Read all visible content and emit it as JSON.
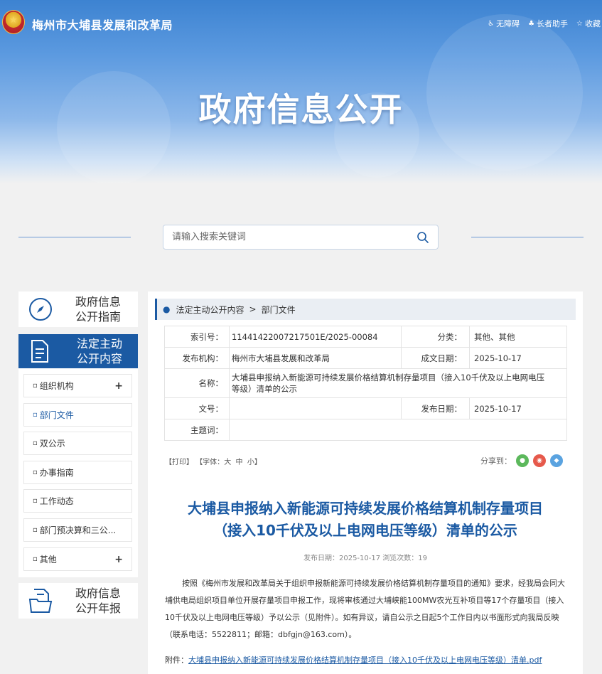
{
  "header": {
    "site_name": "梅州市大埔县发展和改革局",
    "links": [
      {
        "icon": "accessibility-icon",
        "glyph": "♿",
        "label": "无障碍"
      },
      {
        "icon": "elder-assist-icon",
        "glyph": "♣",
        "label": "长者助手"
      },
      {
        "icon": "star-icon",
        "glyph": "☆",
        "label": "收藏"
      }
    ],
    "banner_title": "政府信息公开"
  },
  "search": {
    "placeholder": "请输入搜索关键词"
  },
  "sidebar": {
    "guide": {
      "line1": "政府信息",
      "line2": "公开指南"
    },
    "active": {
      "line1": "法定主动",
      "line2": "公开内容"
    },
    "annual": {
      "line1": "政府信息",
      "line2": "公开年报"
    },
    "items": [
      {
        "label": "组织机构",
        "expand": "+"
      },
      {
        "label": "部门文件",
        "expand": ""
      },
      {
        "label": "双公示",
        "expand": ""
      },
      {
        "label": "办事指南",
        "expand": ""
      },
      {
        "label": "工作动态",
        "expand": ""
      },
      {
        "label": "部门预决算和三公...",
        "expand": ""
      },
      {
        "label": "其他",
        "expand": "+"
      }
    ]
  },
  "breadcrumb": {
    "parent": "法定主动公开内容",
    "separator": ">",
    "current": "部门文件"
  },
  "meta": {
    "index_label": "索引号：",
    "index_value": "11441422007217501E/2025-00084",
    "category_label": "分类：",
    "category_value": "其他、其他",
    "org_label": "发布机构：",
    "org_value": "梅州市大埔县发展和改革局",
    "date_created_label": "成文日期：",
    "date_created_value": "2025-10-17",
    "name_label": "名称：",
    "name_value": "大埔县申报纳入新能源可持续发展价格结算机制存量项目（接入10千伏及以上电网电压等级）清单的公示",
    "docno_label": "文号：",
    "docno_value": "",
    "date_published_label": "发布日期：",
    "date_published_value": "2025-10-17",
    "keywords_label": "主题词：",
    "keywords_value": ""
  },
  "tools": {
    "print": "【打印】",
    "font_prefix": "【字体：",
    "font_large": "大",
    "font_medium": "中",
    "font_small": "小",
    "font_suffix": "】",
    "share_label": "分享到："
  },
  "share_colors": {
    "wechat": "#5cb85c",
    "weibo": "#e6594b",
    "qq": "#5aa3e0"
  },
  "article": {
    "title_line1": "大埔县申报纳入新能源可持续发展价格结算机制存量项目",
    "title_line2": "（接入10千伏及以上电网电压等级）清单的公示",
    "info": "发布日期：2025-10-17  浏览次数：19",
    "body": "按照《梅州市发展和改革局关于组织申报新能源可持续发展价格结算机制存量项目的通知》要求，经我局会同大埔供电局组织项目单位开展存量项目申报工作，现将审核通过大埔峡能100MW农光互补项目等17个存量项目（接入10千伏及以上电网电压等级）予以公示（见附件）。如有异议，请自公示之日起5个工作日内以书面形式向我局反映（联系电话：5522811；邮箱：dbfgjn@163.com）。",
    "attachment_label": "附件：",
    "attachment_link": "大埔县申报纳入新能源可持续发展价格结算机制存量项目（接入10千伏及以上电网电压等级）清单.pdf"
  },
  "colors": {
    "primary": "#1b5aa3",
    "title": "#1b5aa3"
  }
}
